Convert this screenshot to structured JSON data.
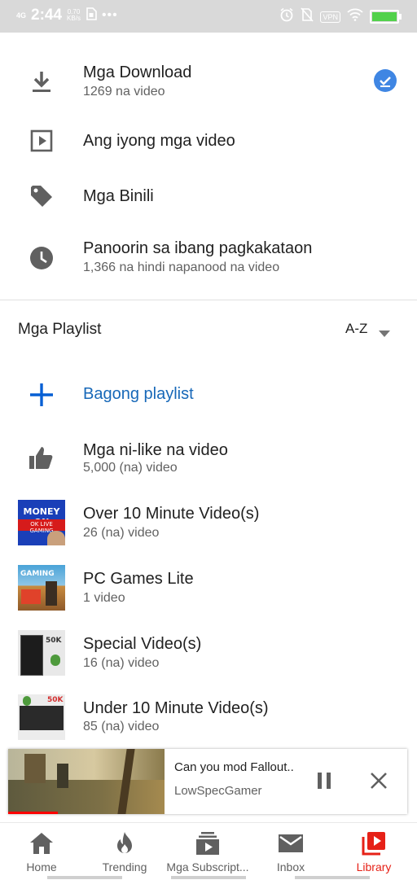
{
  "status_bar": {
    "network": "4G",
    "time": "2:44",
    "speed_value": "0.70",
    "speed_unit": "KB/s",
    "more": "•••",
    "vpn": "VPN",
    "battery_color": "#52d14b"
  },
  "library_items": [
    {
      "icon": "download-icon",
      "title": "Mga Download",
      "subtitle": "1269 na video"
    },
    {
      "icon": "play-box-icon",
      "title": "Ang iyong mga video",
      "subtitle": ""
    },
    {
      "icon": "tag-icon",
      "title": "Mga Binili",
      "subtitle": ""
    },
    {
      "icon": "clock-icon",
      "title": "Panoorin sa ibang pagkakataon",
      "subtitle": "1,366 na hindi napanood na video"
    }
  ],
  "playlists_header": {
    "title": "Mga Playlist",
    "sort": "A-Z"
  },
  "new_playlist": {
    "label": "Bagong playlist"
  },
  "playlists": [
    {
      "icon": "thumbs-up-icon",
      "title": "Mga ni-like na video",
      "subtitle": "5,000 (na) video"
    },
    {
      "thumb_text_1": "MONEY ON",
      "thumb_text_2": "OK LIVE GAMING",
      "title": "Over 10 Minute Video(s)",
      "subtitle": "26 (na) video"
    },
    {
      "thumb_text_1": "GAMING",
      "title": "PC Games Lite",
      "subtitle": "1 video"
    },
    {
      "thumb_text_1": "50K",
      "title": "Special Video(s)",
      "subtitle": "16 (na) video"
    },
    {
      "thumb_text_1": "50K",
      "title": "Under 10 Minute Video(s)",
      "subtitle": "85 (na) video"
    }
  ],
  "mini_player": {
    "title": "Can you mod Fallout..",
    "channel": "LowSpecGamer",
    "progress": 0.32
  },
  "bottom_nav": [
    {
      "icon": "home-icon",
      "label": "Home"
    },
    {
      "icon": "flame-icon",
      "label": "Trending"
    },
    {
      "icon": "subscriptions-icon",
      "label": "Mga Subscript..."
    },
    {
      "icon": "mail-icon",
      "label": "Inbox"
    },
    {
      "icon": "library-icon",
      "label": "Library",
      "active": true
    }
  ],
  "colors": {
    "accent_blue": "#065fd4",
    "badge_blue": "#3f86e3",
    "active_red": "#e62117",
    "icon_gray": "#606060"
  }
}
